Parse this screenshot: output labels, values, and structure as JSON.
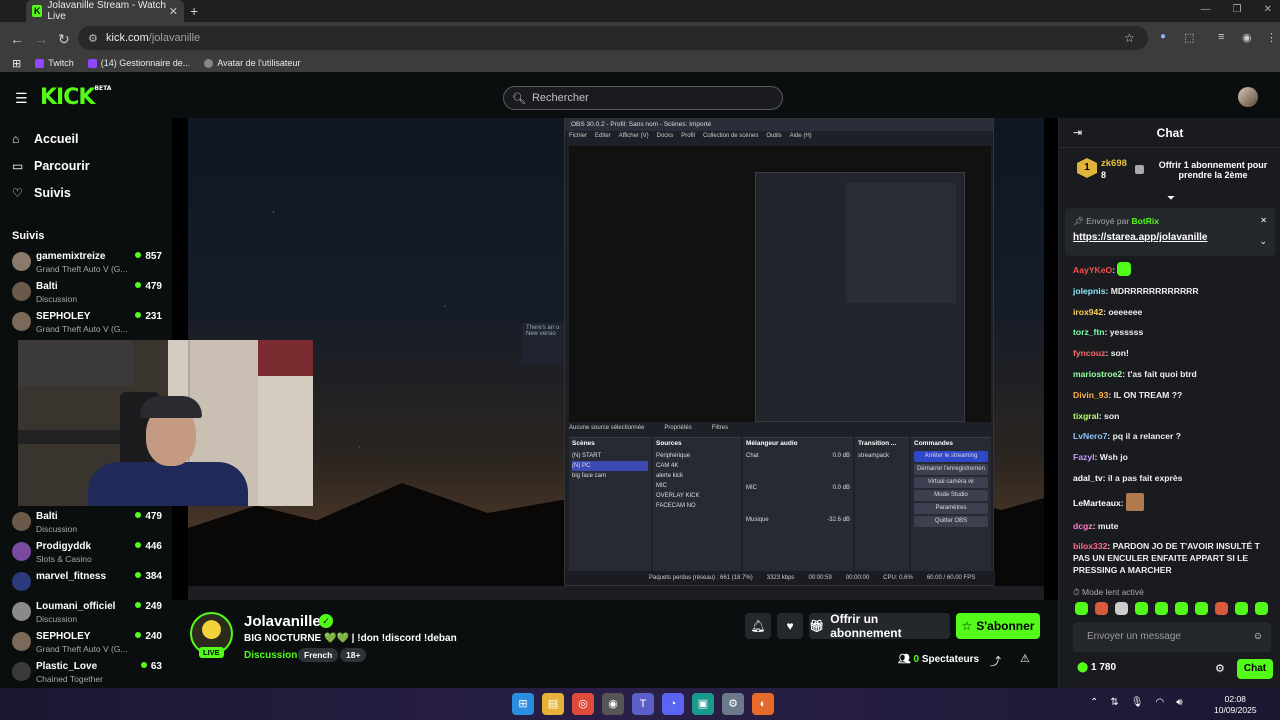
{
  "browser": {
    "tab_title": "Jolavanille Stream - Watch Live",
    "tab_close": "✕",
    "new_tab": "+",
    "url_domain": "kick.com",
    "url_path": "/jolavanille",
    "bookmarks": [
      {
        "label": "Twitch"
      },
      {
        "label": "(14) Gestionnaire de..."
      },
      {
        "label": "Avatar de l'utilisateur"
      }
    ]
  },
  "header": {
    "logo": "KICK",
    "logo_beta": "BETA",
    "search_placeholder": "Rechercher"
  },
  "sidebar": {
    "nav": [
      {
        "label": "Accueil",
        "icon": "home-icon"
      },
      {
        "label": "Parcourir",
        "icon": "browse-icon"
      },
      {
        "label": "Suivis",
        "icon": "heart-icon"
      }
    ],
    "followed_heading": "Suivis",
    "channels": [
      {
        "name": "gamemixtreize",
        "category": "Grand Theft Auto V (G...",
        "viewers": "857",
        "color": "#8a7a6a"
      },
      {
        "name": "Balti",
        "category": "Discussion",
        "viewers": "479",
        "color": "#6a5a4a"
      },
      {
        "name": "SEPHOLEY",
        "category": "Grand Theft Auto V (G...",
        "viewers": "231",
        "color": "#7a6a5a"
      },
      {
        "name": "Balti",
        "category": "Discussion",
        "viewers": "479",
        "color": "#6a5a4a"
      },
      {
        "name": "Prodigyddk",
        "category": "Slots & Casino",
        "viewers": "446",
        "color": "#7a4aa0"
      },
      {
        "name": "marvel_fitness",
        "category": "",
        "viewers": "384",
        "color": "#2a3a7a"
      },
      {
        "name": "Loumani_officiel",
        "category": "Discussion",
        "viewers": "249",
        "color": "#8a8a8a"
      },
      {
        "name": "SEPHOLEY",
        "category": "Grand Theft Auto V (G...",
        "viewers": "240",
        "color": "#7a6a5a"
      },
      {
        "name": "Plastic_Love",
        "category": "Chained Together",
        "viewers": "63",
        "color": "#3a3a3a"
      }
    ]
  },
  "obs": {
    "title": "OBS 30.0.2 - Profil: Sans nom - Scènes: Importé",
    "menu": [
      "Fichier",
      "Editer",
      "Afficher (V)",
      "Docks",
      "Profil",
      "Collection de scènes",
      "Outils",
      "Aide (H)"
    ],
    "no_source": "Aucune source sélectionnée",
    "properties": "Propriétés",
    "filters": "Filtres",
    "scenes_title": "Scènes",
    "scenes": [
      "(N) START",
      "(N) PC",
      "big face cam"
    ],
    "sources_title": "Sources",
    "sources": [
      "Périphérique",
      "CAM 4K",
      "alerte kick",
      "MIC",
      "OVERLAY KICK",
      "FACECAM NO"
    ],
    "mixer_title": "Mélangeur audio",
    "mixer": [
      {
        "name": "Chat",
        "db": "0.0 dB"
      },
      {
        "name": "MIC",
        "db": "0.0 dB"
      },
      {
        "name": "Musique",
        "db": "-32.6 dB"
      }
    ],
    "transition_title": "Transition ...",
    "transition_value": "streampack",
    "controls_title": "Commandes",
    "controls": [
      "Arrêter le streaming",
      "Démarrer l'enregistremen",
      "Virtual caméra vir",
      "Mode Studio",
      "Paramètres",
      "Quitter OBS"
    ],
    "status": [
      "Paquets perdus (réseau) : 661 (18.7%)",
      "3323 kbps",
      "00:00:59",
      "00:00:00",
      "CPU: 0.6%",
      "60.00 / 60.00 FPS"
    ],
    "notification_title": "There's an u",
    "notification_sub": "New versio"
  },
  "stream": {
    "streamer": "Jolavanille",
    "live_label": "LIVE",
    "title": "BIG NOCTURNE 💚💚 | !don !discord !deban",
    "category": "Discussion",
    "tags": [
      "French",
      "18+"
    ],
    "gift_label": "Offrir un abonnement",
    "subscribe_label": "S'abonner",
    "viewers_count": "0",
    "viewers_label": "Spectateurs"
  },
  "chat": {
    "title": "Chat",
    "gifter": {
      "rank": "1",
      "name": "zk698",
      "count": "8",
      "offer": "Offrir 1 abonnement pour prendre la 2ème"
    },
    "pinned_by_label": "Envoyé par",
    "pinned_by": "BotRix",
    "pinned_link": "https://starea.app/jolavanille",
    "messages": [
      {
        "user": "AayYKeO",
        "text": "",
        "color": "#ff4b4b",
        "emote": true
      },
      {
        "user": "jolepnis",
        "text": "MDRRRRRRRRRRRR",
        "color": "#8ee6ff"
      },
      {
        "user": "irox942",
        "text": "oeeeeee",
        "color": "#ffcf5a"
      },
      {
        "user": "torz_ftn",
        "text": "yesssss",
        "color": "#7dffb0"
      },
      {
        "user": "fyncouz",
        "text": "son!",
        "color": "#ff6b6b"
      },
      {
        "user": "mariostroe2",
        "text": "t'as fait quoi btrd",
        "color": "#9affa0"
      },
      {
        "user": "Divin_93",
        "text": "IL ON TREAM ??",
        "color": "#ffb347"
      },
      {
        "user": "tixgral",
        "text": "son",
        "color": "#b7ff6b"
      },
      {
        "user": "LvNero7",
        "text": "pq il a relancer ?",
        "color": "#8ec5ff"
      },
      {
        "user": "Fazyl",
        "text": "Wsh jo",
        "color": "#c79bff"
      },
      {
        "user": "adal_tv",
        "text": "il a pas fait exprès",
        "color": "#ffffff"
      },
      {
        "user": "LeMarteaux",
        "text": "",
        "color": "#ffffff",
        "emote2": true
      },
      {
        "user": "dcgz",
        "text": "mute",
        "color": "#ff7bd0"
      },
      {
        "user": "bilox332",
        "text": "PARDON JO DE T'AVOIR INSULTÉ T PAS UN ENCULER ENFAITE APPART SI LE PRESSING A MARCHER",
        "color": "#ff6b8a"
      }
    ],
    "slow_mode": "Mode lent activé",
    "input_placeholder": "Envoyer un message",
    "points": "1 780",
    "send_label": "Chat"
  },
  "taskbar": {
    "time": "02:08",
    "date": "10/09/2025"
  },
  "colors": {
    "kick_green": "#53fc18",
    "bg": "#0b0e0f",
    "chat_bg": "#191b1f"
  }
}
